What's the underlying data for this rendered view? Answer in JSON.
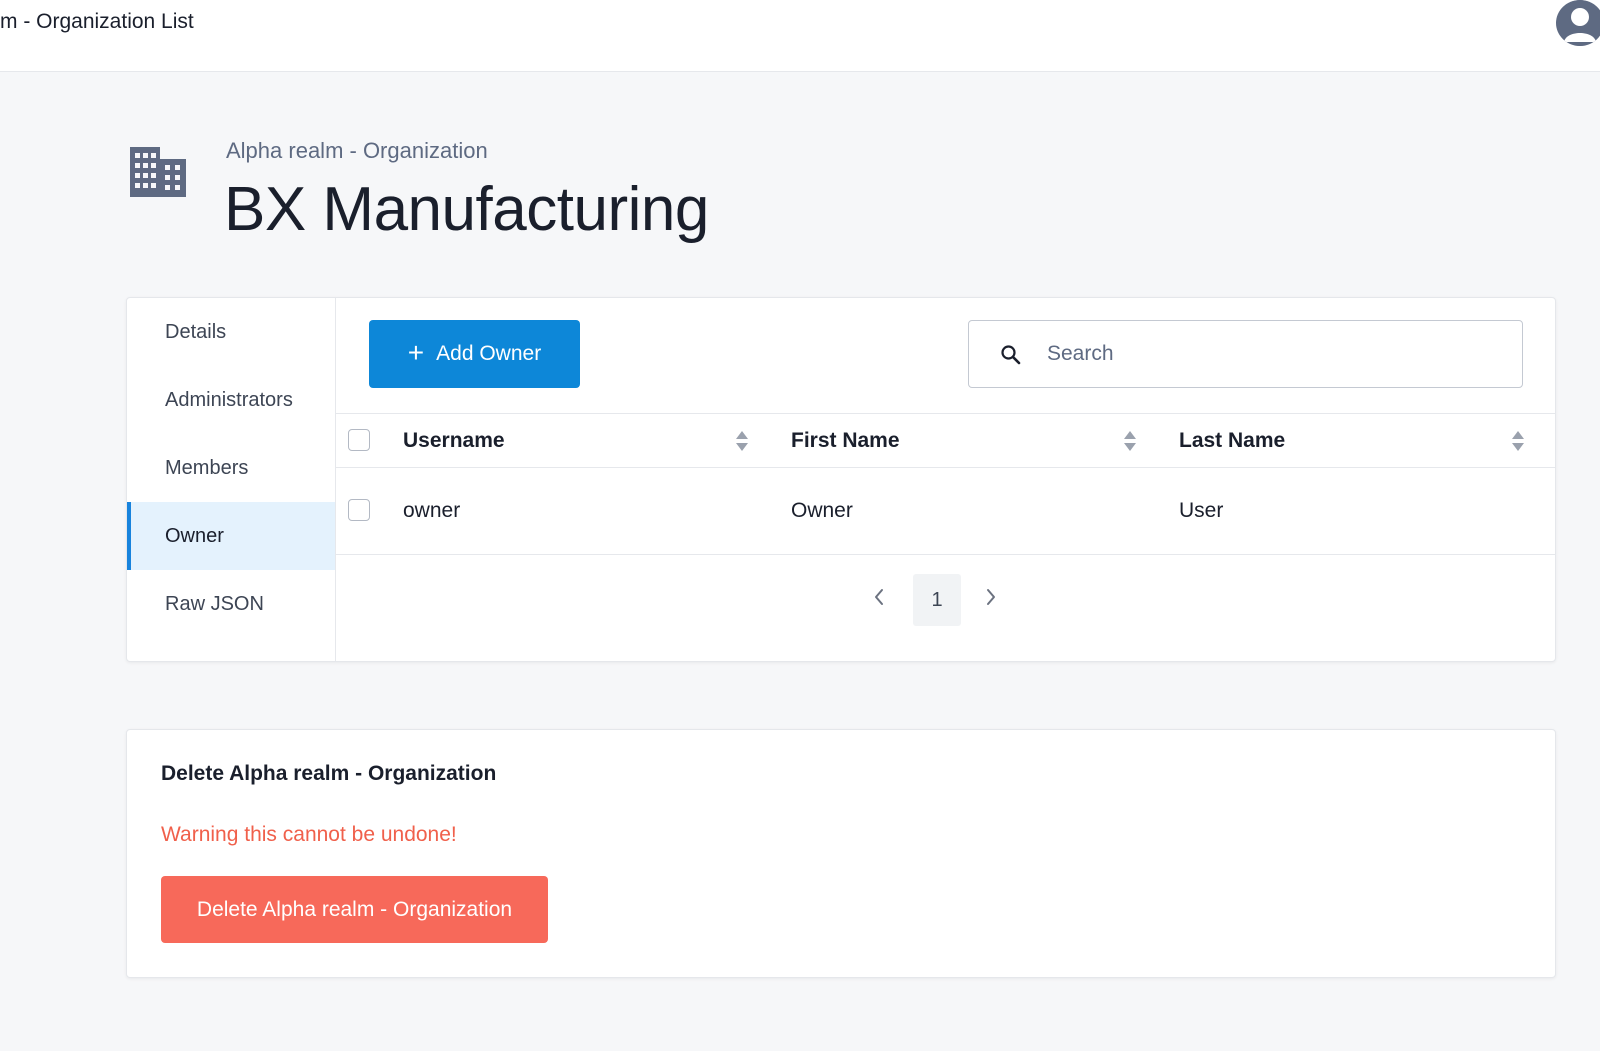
{
  "topbar": {
    "title": "m - Organization List",
    "avatar_icon": "user-avatar-icon"
  },
  "header": {
    "icon": "building-icon",
    "subtitle": "Alpha realm - Organization",
    "title": "BX Manufacturing"
  },
  "sidebar": {
    "items": [
      {
        "label": "Details",
        "active": false
      },
      {
        "label": "Administrators",
        "active": false
      },
      {
        "label": "Members",
        "active": false
      },
      {
        "label": "Owner",
        "active": true
      },
      {
        "label": "Raw JSON",
        "active": false
      }
    ]
  },
  "toolbar": {
    "add_label": "Add Owner",
    "search_placeholder": "Search"
  },
  "table": {
    "columns": [
      "Username",
      "First Name",
      "Last Name"
    ],
    "rows": [
      {
        "username": "owner",
        "first_name": "Owner",
        "last_name": "User"
      }
    ]
  },
  "pagination": {
    "current_page": "1"
  },
  "danger_zone": {
    "title": "Delete Alpha realm - Organization",
    "warning": "Warning this cannot be undone!",
    "button_label": "Delete Alpha realm - Organization"
  },
  "colors": {
    "primary": "#0d87d8",
    "danger": "#f7695a",
    "warning_text": "#f0604b",
    "active_nav_bg": "#e4f2fd",
    "active_nav_border": "#1883dd"
  }
}
